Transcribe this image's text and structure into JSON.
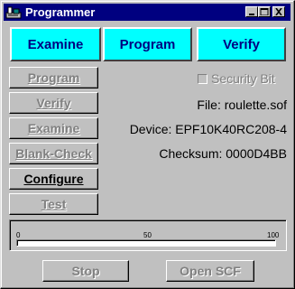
{
  "window": {
    "title": "Programmer",
    "controls": {
      "minimize_icon": "minimize-icon",
      "maximize_icon": "maximize-icon",
      "close_icon": "close-icon"
    }
  },
  "mode_buttons": [
    {
      "label": "Examine",
      "color": "#00ffff"
    },
    {
      "label": "Program",
      "color": "#00ffff"
    },
    {
      "label": "Verify",
      "color": "#00ffff"
    }
  ],
  "actions": [
    {
      "label": "Program",
      "enabled": false
    },
    {
      "label": "Verify",
      "enabled": false
    },
    {
      "label": "Examine",
      "enabled": false
    },
    {
      "label": "Blank-Check",
      "enabled": false
    },
    {
      "label": "Configure",
      "enabled": true
    },
    {
      "label": "Test",
      "enabled": false
    }
  ],
  "security_bit": {
    "label": "Security Bit",
    "checked": false,
    "enabled": false
  },
  "info": {
    "file": "File: roulette.sof",
    "device": "Device: EPF10K40RC208-4",
    "checksum": "Checksum: 0000D4BB"
  },
  "progress": {
    "ticks": [
      "0",
      "50",
      "100"
    ],
    "value_percent": 0
  },
  "bottom_buttons": [
    {
      "label": "Stop",
      "enabled": false
    },
    {
      "label": "Open SCF",
      "enabled": false
    }
  ],
  "colors": {
    "titlebar": "#000080",
    "mode_button": "#00ffff",
    "mode_button_text": "#000080",
    "face": "#c0c0c0"
  }
}
